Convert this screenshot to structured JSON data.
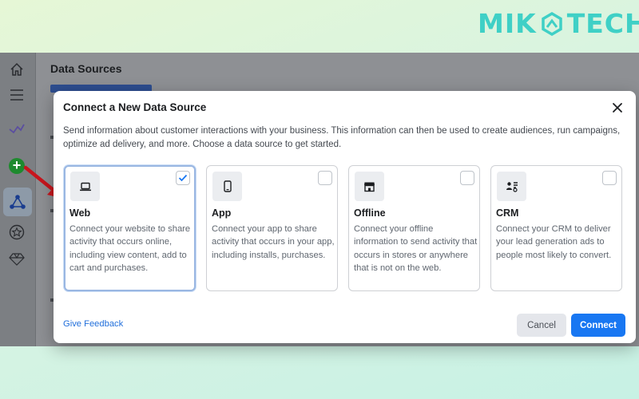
{
  "brand": {
    "text_left": "MIK",
    "text_right": "TECH",
    "color": "#3fd0c6"
  },
  "page": {
    "title": "Data Sources"
  },
  "sidebar": {
    "icons": [
      "home-icon",
      "menu-icon",
      "analytics-icon",
      "add-icon",
      "data-sources-icon",
      "star-icon",
      "diamond-icon"
    ],
    "active": "data-sources-icon",
    "add_label": "+"
  },
  "modal": {
    "title": "Connect a New Data Source",
    "description": "Send information about customer interactions with your business. This information can then be used to create audiences, run campaigns, optimize ad delivery, and more. Choose a data source to get started.",
    "options": [
      {
        "title": "Web",
        "icon": "laptop-icon",
        "selected": true,
        "description": "Connect your website to share activity that occurs online, including view content, add to cart and purchases."
      },
      {
        "title": "App",
        "icon": "phone-icon",
        "selected": false,
        "description": "Connect your app to share activity that occurs in your app, including installs, purchases."
      },
      {
        "title": "Offline",
        "icon": "store-icon",
        "selected": false,
        "description": "Connect your offline information to send activity that occurs in stores or anywhere that is not on the web."
      },
      {
        "title": "CRM",
        "icon": "crm-icon",
        "selected": false,
        "description": "Connect your CRM to deliver your lead generation ads to people most likely to convert."
      }
    ],
    "feedback_label": "Give Feedback",
    "cancel_label": "Cancel",
    "connect_label": "Connect"
  },
  "colors": {
    "accent": "#1877f2",
    "link": "#216fdb",
    "annotation_arrow": "#c8151d",
    "add_button": "#1e8a2e"
  }
}
